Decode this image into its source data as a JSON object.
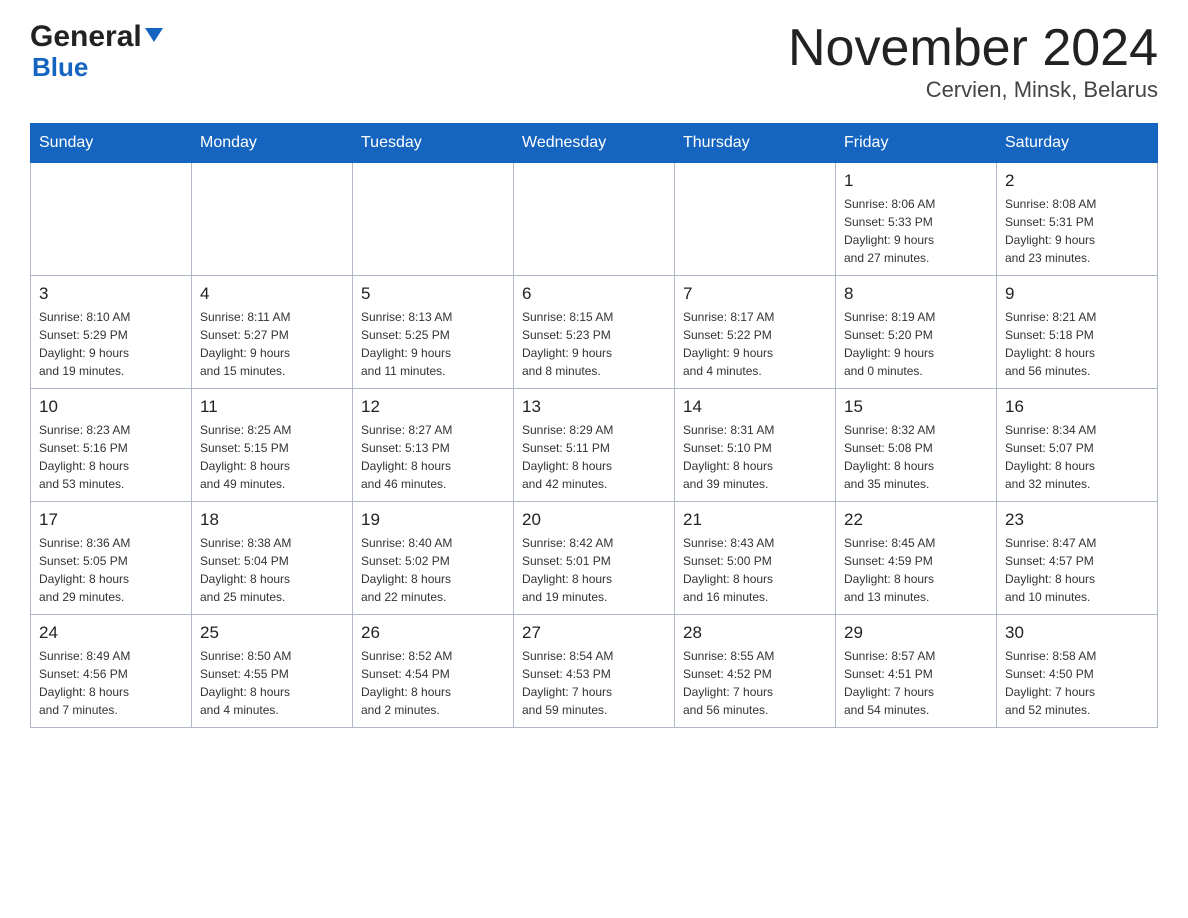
{
  "header": {
    "logo_general": "General",
    "logo_blue": "Blue",
    "month_title": "November 2024",
    "location": "Cervien, Minsk, Belarus"
  },
  "weekdays": [
    "Sunday",
    "Monday",
    "Tuesday",
    "Wednesday",
    "Thursday",
    "Friday",
    "Saturday"
  ],
  "weeks": [
    [
      {
        "day": "",
        "info": ""
      },
      {
        "day": "",
        "info": ""
      },
      {
        "day": "",
        "info": ""
      },
      {
        "day": "",
        "info": ""
      },
      {
        "day": "",
        "info": ""
      },
      {
        "day": "1",
        "info": "Sunrise: 8:06 AM\nSunset: 5:33 PM\nDaylight: 9 hours\nand 27 minutes."
      },
      {
        "day": "2",
        "info": "Sunrise: 8:08 AM\nSunset: 5:31 PM\nDaylight: 9 hours\nand 23 minutes."
      }
    ],
    [
      {
        "day": "3",
        "info": "Sunrise: 8:10 AM\nSunset: 5:29 PM\nDaylight: 9 hours\nand 19 minutes."
      },
      {
        "day": "4",
        "info": "Sunrise: 8:11 AM\nSunset: 5:27 PM\nDaylight: 9 hours\nand 15 minutes."
      },
      {
        "day": "5",
        "info": "Sunrise: 8:13 AM\nSunset: 5:25 PM\nDaylight: 9 hours\nand 11 minutes."
      },
      {
        "day": "6",
        "info": "Sunrise: 8:15 AM\nSunset: 5:23 PM\nDaylight: 9 hours\nand 8 minutes."
      },
      {
        "day": "7",
        "info": "Sunrise: 8:17 AM\nSunset: 5:22 PM\nDaylight: 9 hours\nand 4 minutes."
      },
      {
        "day": "8",
        "info": "Sunrise: 8:19 AM\nSunset: 5:20 PM\nDaylight: 9 hours\nand 0 minutes."
      },
      {
        "day": "9",
        "info": "Sunrise: 8:21 AM\nSunset: 5:18 PM\nDaylight: 8 hours\nand 56 minutes."
      }
    ],
    [
      {
        "day": "10",
        "info": "Sunrise: 8:23 AM\nSunset: 5:16 PM\nDaylight: 8 hours\nand 53 minutes."
      },
      {
        "day": "11",
        "info": "Sunrise: 8:25 AM\nSunset: 5:15 PM\nDaylight: 8 hours\nand 49 minutes."
      },
      {
        "day": "12",
        "info": "Sunrise: 8:27 AM\nSunset: 5:13 PM\nDaylight: 8 hours\nand 46 minutes."
      },
      {
        "day": "13",
        "info": "Sunrise: 8:29 AM\nSunset: 5:11 PM\nDaylight: 8 hours\nand 42 minutes."
      },
      {
        "day": "14",
        "info": "Sunrise: 8:31 AM\nSunset: 5:10 PM\nDaylight: 8 hours\nand 39 minutes."
      },
      {
        "day": "15",
        "info": "Sunrise: 8:32 AM\nSunset: 5:08 PM\nDaylight: 8 hours\nand 35 minutes."
      },
      {
        "day": "16",
        "info": "Sunrise: 8:34 AM\nSunset: 5:07 PM\nDaylight: 8 hours\nand 32 minutes."
      }
    ],
    [
      {
        "day": "17",
        "info": "Sunrise: 8:36 AM\nSunset: 5:05 PM\nDaylight: 8 hours\nand 29 minutes."
      },
      {
        "day": "18",
        "info": "Sunrise: 8:38 AM\nSunset: 5:04 PM\nDaylight: 8 hours\nand 25 minutes."
      },
      {
        "day": "19",
        "info": "Sunrise: 8:40 AM\nSunset: 5:02 PM\nDaylight: 8 hours\nand 22 minutes."
      },
      {
        "day": "20",
        "info": "Sunrise: 8:42 AM\nSunset: 5:01 PM\nDaylight: 8 hours\nand 19 minutes."
      },
      {
        "day": "21",
        "info": "Sunrise: 8:43 AM\nSunset: 5:00 PM\nDaylight: 8 hours\nand 16 minutes."
      },
      {
        "day": "22",
        "info": "Sunrise: 8:45 AM\nSunset: 4:59 PM\nDaylight: 8 hours\nand 13 minutes."
      },
      {
        "day": "23",
        "info": "Sunrise: 8:47 AM\nSunset: 4:57 PM\nDaylight: 8 hours\nand 10 minutes."
      }
    ],
    [
      {
        "day": "24",
        "info": "Sunrise: 8:49 AM\nSunset: 4:56 PM\nDaylight: 8 hours\nand 7 minutes."
      },
      {
        "day": "25",
        "info": "Sunrise: 8:50 AM\nSunset: 4:55 PM\nDaylight: 8 hours\nand 4 minutes."
      },
      {
        "day": "26",
        "info": "Sunrise: 8:52 AM\nSunset: 4:54 PM\nDaylight: 8 hours\nand 2 minutes."
      },
      {
        "day": "27",
        "info": "Sunrise: 8:54 AM\nSunset: 4:53 PM\nDaylight: 7 hours\nand 59 minutes."
      },
      {
        "day": "28",
        "info": "Sunrise: 8:55 AM\nSunset: 4:52 PM\nDaylight: 7 hours\nand 56 minutes."
      },
      {
        "day": "29",
        "info": "Sunrise: 8:57 AM\nSunset: 4:51 PM\nDaylight: 7 hours\nand 54 minutes."
      },
      {
        "day": "30",
        "info": "Sunrise: 8:58 AM\nSunset: 4:50 PM\nDaylight: 7 hours\nand 52 minutes."
      }
    ]
  ]
}
